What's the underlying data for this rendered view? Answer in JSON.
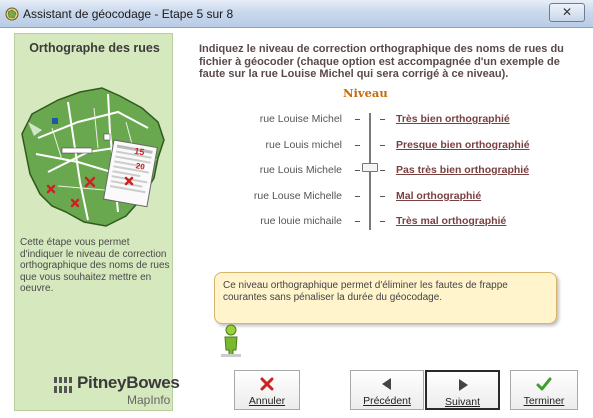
{
  "window": {
    "title": "Assistant de géocodage - Etape 5 sur 8",
    "close_symbol": "✕"
  },
  "sidebar": {
    "title": "Orthographe des rues",
    "description": "Cette étape vous permet d'indiquer le niveau de correction orthographique des noms de rues que vous souhaitez mettre en oeuvre.",
    "logo": {
      "name": "PitneyBowes",
      "product": "MapInfo"
    }
  },
  "main": {
    "instruction": "Indiquez le niveau de correction orthographique des noms de rues du fichier à géocoder (chaque option est accompagnée d'un exemple de faute sur la rue Louise Michel qui sera corrigé à ce niveau).",
    "level_heading": "Niveau",
    "levels": [
      {
        "example": "rue Louise Michel",
        "label": "Très bien orthographié"
      },
      {
        "example": "rue Louis michel",
        "label": "Presque bien orthographié"
      },
      {
        "example": "rue Louis Michele",
        "label": "Pas très bien orthographié"
      },
      {
        "example": "rue Louse Michelle",
        "label": "Mal orthographié"
      },
      {
        "example": "rue louie michaile",
        "label": "Très mal orthographié"
      }
    ],
    "selected_level": 3,
    "info_text": "Ce niveau orthographique permet d'éliminer les fautes de frappe courantes sans pénaliser la durée du géocodage."
  },
  "buttons": {
    "cancel": "Annuler",
    "previous": "Précédent",
    "next": "Suivant",
    "finish": "Terminer"
  },
  "colors": {
    "sidebar_bg": "#d6e8bd",
    "accent_orange": "#c96a06",
    "link": "#7a4040",
    "info_bg": "#fff4cc",
    "cancel_red": "#cc2222",
    "finish_green": "#3aa02a"
  },
  "icons": {
    "app": "globe-icon",
    "cancel": "red-x-icon",
    "previous": "arrow-left-icon",
    "next": "arrow-right-icon",
    "finish": "green-check-icon",
    "assistant": "person-icon"
  }
}
